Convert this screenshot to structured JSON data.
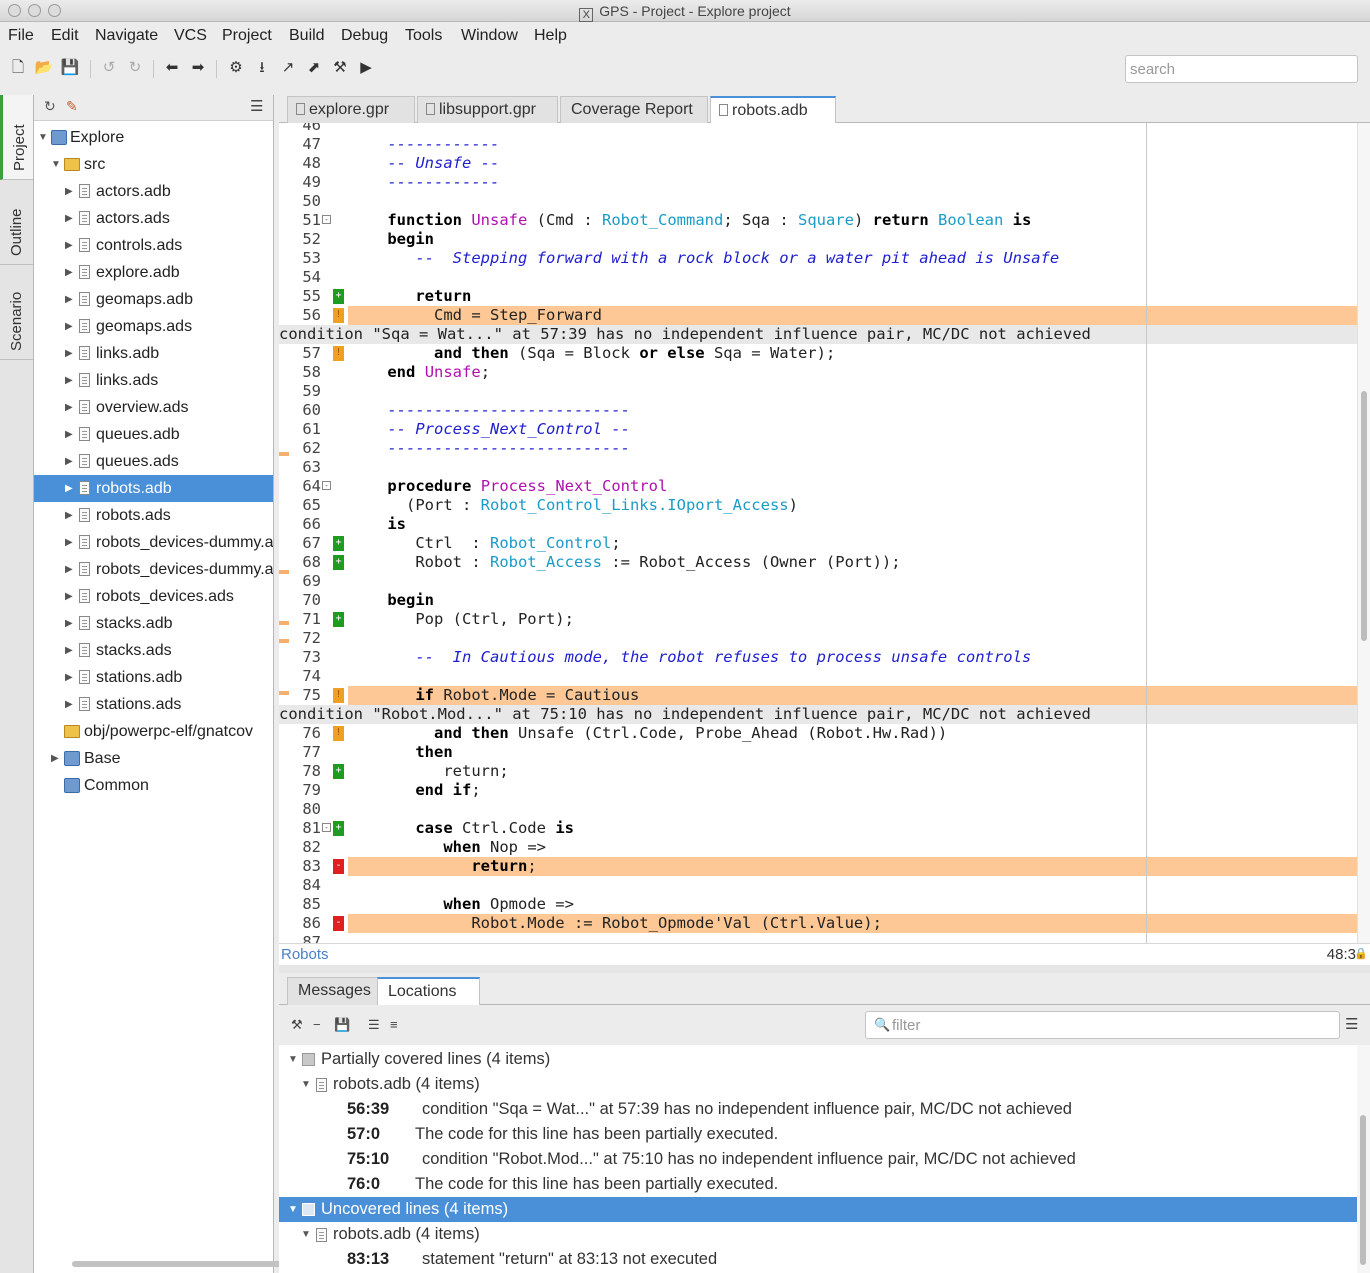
{
  "window": {
    "title": "GPS - Project - Explore project"
  },
  "menu": [
    "File",
    "Edit",
    "Navigate",
    "VCS",
    "Project",
    "Build",
    "Debug",
    "Tools",
    "Window",
    "Help"
  ],
  "toolbar": {
    "search_placeholder": "search",
    "icons": [
      "new-file-icon",
      "open-folder-icon",
      "save-icon",
      "undo-icon",
      "redo-icon",
      "back-icon",
      "forward-icon",
      "compile-icon",
      "build-icon",
      "build-main-icon",
      "build-all-icon",
      "clean-icon",
      "run-icon"
    ]
  },
  "side_tabs": [
    "Project",
    "Outline",
    "Scenario"
  ],
  "project_tree": {
    "root": "Explore",
    "src": "src",
    "files": [
      "actors.adb",
      "actors.ads",
      "controls.ads",
      "explore.adb",
      "geomaps.adb",
      "geomaps.ads",
      "links.adb",
      "links.ads",
      "overview.ads",
      "queues.adb",
      "queues.ads",
      "robots.adb",
      "robots.ads",
      "robots_devices-dummy.a",
      "robots_devices-dummy.a",
      "robots_devices.ads",
      "stacks.adb",
      "stacks.ads",
      "stations.adb",
      "stations.ads"
    ],
    "selected": "robots.adb",
    "obj_dir": "obj/powerpc-elf/gnatcov",
    "other_projects": [
      "Base",
      "Common"
    ]
  },
  "editor_tabs": [
    "explore.gpr",
    "libsupport.gpr",
    "Coverage Report",
    "robots.adb"
  ],
  "editor": {
    "active_tab": "robots.adb",
    "context": "Robots",
    "cursor": "48:3",
    "msg1": "condition \"Sqa = Wat...\" at 57:39 has no independent influence pair, MC/DC not achieved",
    "msg2": "condition \"Robot.Mod...\" at 75:10 has no independent influence pair, MC/DC not achieved"
  },
  "bottom_tabs": [
    "Messages",
    "Locations"
  ],
  "locations": {
    "filter_placeholder": "filter",
    "group1": "Partially covered lines (4 items)",
    "group1_file": "robots.adb (4 items)",
    "group1_items": [
      {
        "loc": "56:39",
        "text": "condition \"Sqa = Wat...\" at 57:39 has no independent influence pair, MC/DC not achieved"
      },
      {
        "loc": "57:0",
        "text": "The code for this line has been partially executed."
      },
      {
        "loc": "75:10",
        "text": "condition \"Robot.Mod...\" at 75:10 has no independent influence pair, MC/DC not achieved"
      },
      {
        "loc": "76:0",
        "text": "The code for this line has been partially executed."
      }
    ],
    "group2": "Uncovered lines (4 items)",
    "group2_file": "robots.adb (4 items)",
    "group2_items": [
      {
        "loc": "83:13",
        "text": "statement \"return\" at 83:13 not executed"
      }
    ]
  },
  "colors": {
    "selection": "#4a90d9",
    "highlight_line": "#fdc895",
    "covered_marker": "#1f9b1f",
    "partial_marker": "#f0a020",
    "uncovered_marker": "#e02020",
    "type_color": "#1a9bc7",
    "function_color": "#b010b0",
    "comment_color": "#2020d0"
  }
}
